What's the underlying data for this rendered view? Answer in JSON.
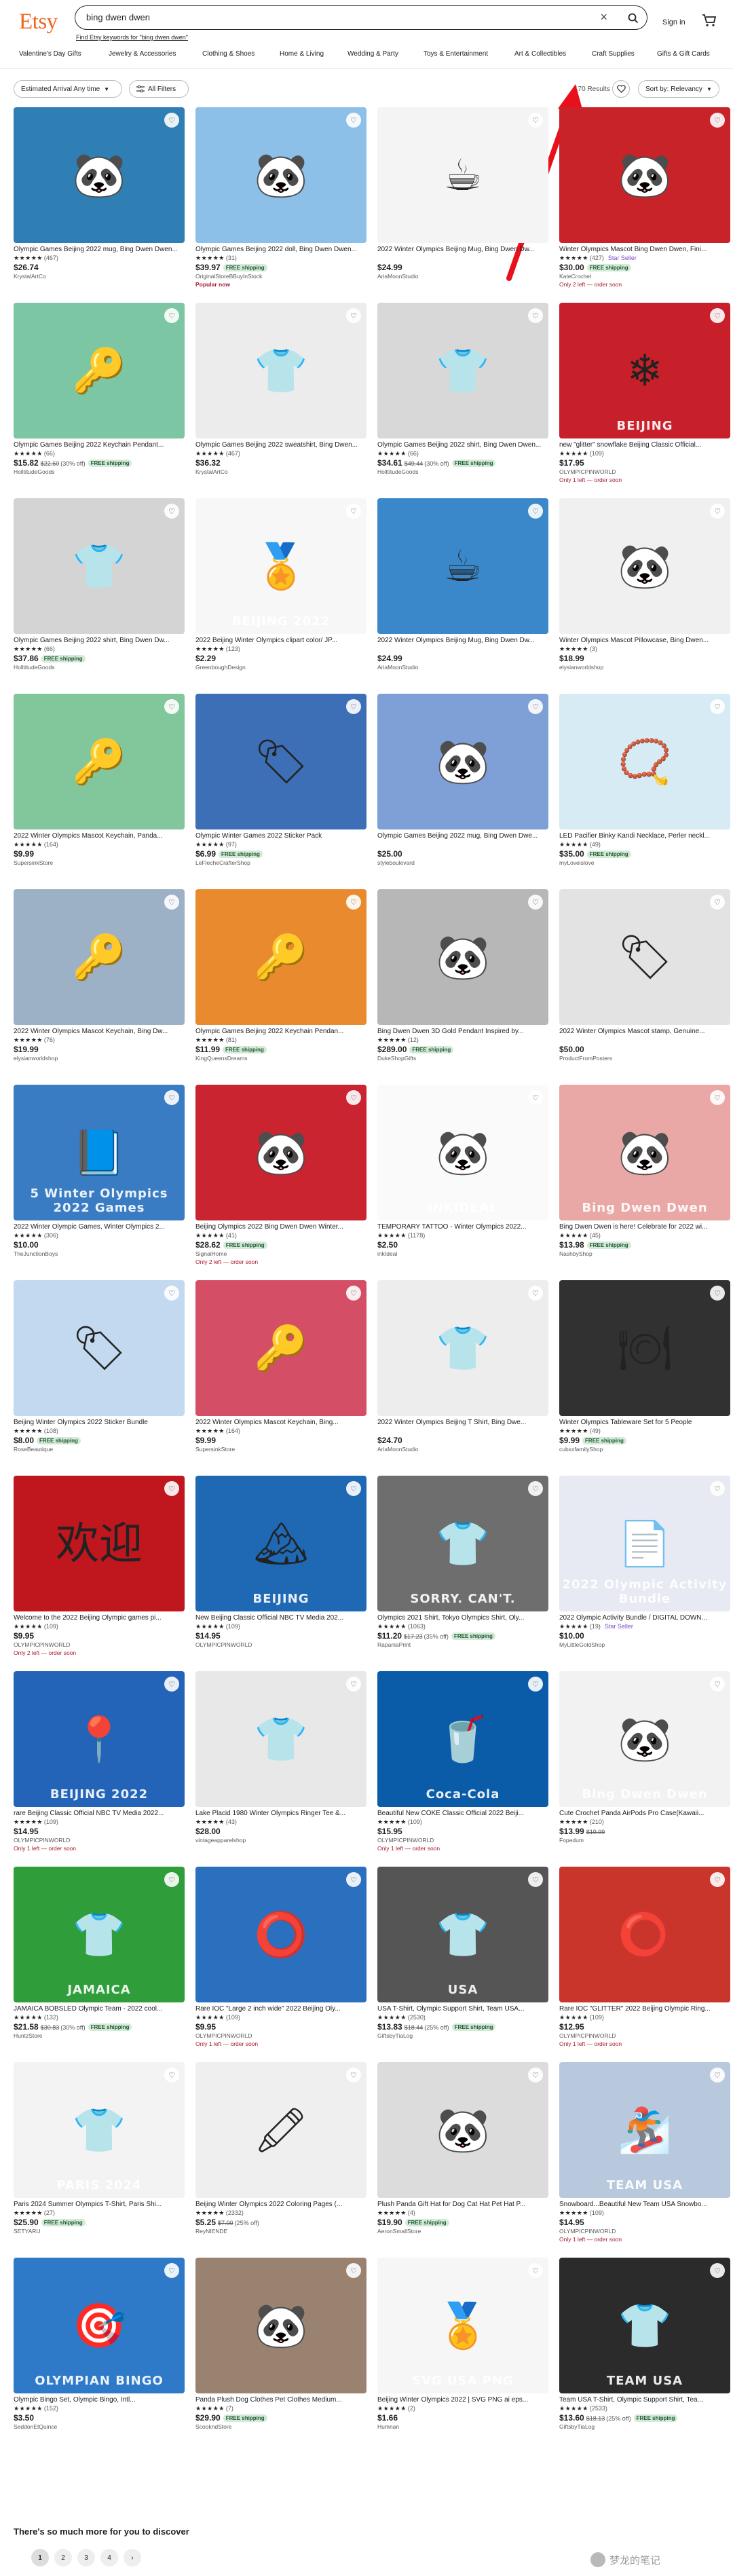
{
  "header": {
    "logo": "Etsy",
    "search_value": "bing dwen dwen",
    "clear_symbol": "×",
    "signin": "Sign in",
    "spell_suggestion": "Find Etsy keywords for \"bing dwen dwen\""
  },
  "categories": [
    "Valentine's Day Gifts",
    "Jewelry & Accessories",
    "Clothing & Shoes",
    "Home & Living",
    "Wedding & Party",
    "Toys & Entertainment",
    "Art & Collectibles",
    "Craft Supplies",
    "Gifts & Gift Cards"
  ],
  "filters": {
    "arrival": "Estimated Arrival Any time",
    "all_filters": "All Filters",
    "results": "170 Results",
    "sort": "Sort by: Relevancy"
  },
  "products": [
    {
      "title": "Olympic Games Beijing 2022 mug, Bing Dwen Dwen...",
      "rating": "★★★★★",
      "count": "(467)",
      "price": "$26.74",
      "shop": "KrystalArtCo",
      "note": "",
      "ship": "",
      "bg": "#2f7fb5",
      "glyph": "🐼",
      "caption": "",
      "seller": ""
    },
    {
      "title": "Olympic Games Beijing 2022 doll, Bing Dwen Dwen...",
      "rating": "★★★★★",
      "count": "(31)",
      "price": "$39.97",
      "shop": "OriginalStoreBBuyInStock",
      "note": "Popular now",
      "ship": "FREE shipping",
      "bg": "#8cc0e8",
      "glyph": "🐼",
      "caption": "",
      "seller": ""
    },
    {
      "title": "2022 Winter Olympics Beijing Mug, Bing Dwen Dw...",
      "rating": "",
      "count": "",
      "price": "$24.99",
      "shop": "AriaMoonStudio",
      "note": "",
      "ship": "",
      "bg": "#f4f4f4",
      "glyph": "☕",
      "caption": "",
      "seller": ""
    },
    {
      "title": "Winter Olympics Mascot Bing Dwen Dwen, Fini...",
      "rating": "★★★★★",
      "count": "(427)",
      "price": "$30.00",
      "shop": "KateCrochet",
      "note": "Only 2 left — order soon",
      "ship": "FREE shipping",
      "bg": "#c9232a",
      "glyph": "🐼",
      "caption": "",
      "seller": "Star Seller"
    },
    {
      "title": "Olympic Games Beijing 2022 Keychain Pendant...",
      "rating": "★★★★★",
      "count": "(66)",
      "price": "$15.82",
      "shop": "HolltitudeGoods",
      "note": "",
      "ship": "FREE shipping",
      "bg": "#7cc6a3",
      "glyph": "🔑",
      "caption": "",
      "seller": "",
      "orig": "$22.60",
      "disc": "(30% off)"
    },
    {
      "title": "Olympic Games Beijing 2022 sweatshirt, Bing Dwen...",
      "rating": "★★★★★",
      "count": "(467)",
      "price": "$36.32",
      "shop": "KrystalArtCo",
      "note": "",
      "ship": "",
      "bg": "#ececec",
      "glyph": "👕",
      "caption": "",
      "seller": ""
    },
    {
      "title": "Olympic Games Beijing 2022 shirt, Bing Dwen Dwen...",
      "rating": "★★★★★",
      "count": "(66)",
      "price": "$34.61",
      "shop": "HolltitudeGoods",
      "note": "",
      "ship": "FREE shipping",
      "bg": "#d8d8d8",
      "glyph": "👕",
      "caption": "",
      "seller": "",
      "orig": "$49.44",
      "disc": "(30% off)"
    },
    {
      "title": "new \"glitter\" snowflake Beijing Classic Official...",
      "rating": "★★★★★",
      "count": "(109)",
      "price": "$17.95",
      "shop": "OLYMPICPINWORLD",
      "note": "Only 1 left — order soon",
      "ship": "",
      "bg": "#c8202a",
      "glyph": "❄",
      "caption": "BEIJING",
      "seller": ""
    },
    {
      "title": "Olympic Games Beijing 2022 shirt, Bing Dwen Dw...",
      "rating": "★★★★★",
      "count": "(66)",
      "price": "$37.86",
      "shop": "HolltitudeGoods",
      "note": "",
      "ship": "FREE shipping",
      "bg": "#d4d4d4",
      "glyph": "👕",
      "caption": "",
      "seller": ""
    },
    {
      "title": "2022 Beijing Winter Olympics clipart color/ JP...",
      "rating": "★★★★★",
      "count": "(123)",
      "price": "$2.29",
      "shop": "GreenboughDesign",
      "note": "",
      "ship": "",
      "bg": "#f7f7f7",
      "glyph": "🏅",
      "caption": "BEIJING 2022",
      "seller": ""
    },
    {
      "title": "2022 Winter Olympics Beijing Mug, Bing Dwen Dw...",
      "rating": "",
      "count": "",
      "price": "$24.99",
      "shop": "AriaMoonStudio",
      "note": "",
      "ship": "",
      "bg": "#3a88c9",
      "glyph": "☕",
      "caption": "",
      "seller": ""
    },
    {
      "title": "Winter Olympics Mascot Pillowcase, Bing Dwen...",
      "rating": "★★★★★",
      "count": "(3)",
      "price": "$18.99",
      "shop": "elysianworldshop",
      "note": "",
      "ship": "",
      "bg": "#f0f0f0",
      "glyph": "🐼",
      "caption": "",
      "seller": ""
    },
    {
      "title": "2022 Winter Olympics Mascot Keychain, Panda...",
      "rating": "★★★★★",
      "count": "(164)",
      "price": "$9.99",
      "shop": "SupersinkStore",
      "note": "",
      "ship": "",
      "bg": "#82c79c",
      "glyph": "🔑",
      "caption": "",
      "seller": ""
    },
    {
      "title": "Olympic Winter Games 2022 Sticker Pack",
      "rating": "★★★★★",
      "count": "(97)",
      "price": "$6.99",
      "shop": "LeFlecheCrafterShop",
      "note": "",
      "ship": "FREE shipping",
      "bg": "#3c6fb6",
      "glyph": "🏷",
      "caption": "",
      "seller": ""
    },
    {
      "title": "Olympic Games Beijing 2022 mug, Bing Dwen Dwe...",
      "rating": "",
      "count": "",
      "price": "$25.00",
      "shop": "styleboulevard",
      "note": "",
      "ship": "",
      "bg": "#7fa0d6",
      "glyph": "🐼",
      "caption": "",
      "seller": ""
    },
    {
      "title": "LED Pacifier Binky Kandi Necklace, Perler neckl...",
      "rating": "★★★★★",
      "count": "(49)",
      "price": "$35.00",
      "shop": "myLoveislove",
      "note": "",
      "ship": "FREE shipping",
      "bg": "#d7ebf5",
      "glyph": "📿",
      "caption": "",
      "seller": ""
    },
    {
      "title": "2022 Winter Olympics Mascot Keychain, Bing Dw...",
      "rating": "★★★★★",
      "count": "(76)",
      "price": "$19.99",
      "shop": "elysianworldshop",
      "note": "",
      "ship": "",
      "bg": "#9cb0c6",
      "glyph": "🔑",
      "caption": "",
      "seller": ""
    },
    {
      "title": "Olympic Games Beijing 2022 Keychain Pendan...",
      "rating": "★★★★★",
      "count": "(81)",
      "price": "$11.99",
      "shop": "KingQueensDreams",
      "note": "",
      "ship": "FREE shipping",
      "bg": "#e98a2f",
      "glyph": "🔑",
      "caption": "",
      "seller": ""
    },
    {
      "title": "Bing Dwen Dwen 3D Gold Pendant Inspired by...",
      "rating": "★★★★★",
      "count": "(12)",
      "price": "$289.00",
      "shop": "DukeShopGifts",
      "note": "",
      "ship": "FREE shipping",
      "bg": "#b7b7b7",
      "glyph": "🐼",
      "caption": "",
      "seller": ""
    },
    {
      "title": "2022 Winter Olympics Mascot stamp, Genuine...",
      "rating": "",
      "count": "",
      "price": "$50.00",
      "shop": "ProductFromPosters",
      "note": "",
      "ship": "",
      "bg": "#e3e3e3",
      "glyph": "🏷",
      "caption": "",
      "seller": ""
    },
    {
      "title": "2022 Winter Olympic Games, Winter Olympics 2...",
      "rating": "★★★★★",
      "count": "(306)",
      "price": "$10.00",
      "shop": "TheJunctionBoys",
      "note": "",
      "ship": "",
      "bg": "#3a7cc4",
      "glyph": "📘",
      "caption": "5 Winter Olympics 2022 Games",
      "seller": ""
    },
    {
      "title": "Beijing Olympics 2022 Bing Dwen Dwen Winter...",
      "rating": "★★★★★",
      "count": "(41)",
      "price": "$28.62",
      "shop": "SignalHome",
      "note": "Only 2 left — order soon",
      "ship": "FREE shipping",
      "bg": "#c92430",
      "glyph": "🐼",
      "caption": "",
      "seller": ""
    },
    {
      "title": "TEMPORARY TATTOO - Winter Olympics 2022...",
      "rating": "★★★★★",
      "count": "(1178)",
      "price": "$2.50",
      "shop": "inkIdeal",
      "note": "",
      "ship": "",
      "bg": "#fafafa",
      "glyph": "🐼",
      "caption": "iNKIDEAL",
      "seller": ""
    },
    {
      "title": "Bing Dwen Dwen is here! Celebrate for 2022 wi...",
      "rating": "★★★★★",
      "count": "(45)",
      "price": "$13.98",
      "shop": "NashbyShop",
      "note": "",
      "ship": "FREE shipping",
      "bg": "#e9a8a5",
      "glyph": "🐼",
      "caption": "Bing Dwen Dwen",
      "seller": ""
    },
    {
      "title": "Beijing Winter Olympics 2022 Sticker Bundle",
      "rating": "★★★★★",
      "count": "(108)",
      "price": "$8.00",
      "shop": "RoseBeautique",
      "note": "",
      "ship": "FREE shipping",
      "bg": "#c2d9ef",
      "glyph": "🏷",
      "caption": "",
      "seller": ""
    },
    {
      "title": "2022 Winter Olympics Mascot Keychain, Bing...",
      "rating": "★★★★★",
      "count": "(164)",
      "price": "$9.99",
      "shop": "SupersinkStore",
      "note": "",
      "ship": "",
      "bg": "#d44f65",
      "glyph": "🔑",
      "caption": "",
      "seller": ""
    },
    {
      "title": "2022 Winter Olympics Beijing T Shirt, Bing Dwe...",
      "rating": "",
      "count": "",
      "price": "$24.70",
      "shop": "AriaMoonStudio",
      "note": "",
      "ship": "",
      "bg": "#ededed",
      "glyph": "👕",
      "caption": "",
      "seller": ""
    },
    {
      "title": "Winter Olympics Tableware Set for 5 People",
      "rating": "★★★★★",
      "count": "(49)",
      "price": "$9.99",
      "shop": "cubxxfamilyShop",
      "note": "",
      "ship": "FREE shipping",
      "bg": "#313131",
      "glyph": "🍽",
      "caption": "",
      "seller": ""
    },
    {
      "title": "Welcome to the 2022 Beijing Olympic games pi...",
      "rating": "★★★★★",
      "count": "(109)",
      "price": "$9.95",
      "shop": "OLYMPICPINWORLD",
      "note": "Only 2 left — order soon",
      "ship": "",
      "bg": "#c0161e",
      "glyph": "欢迎",
      "caption": "",
      "seller": ""
    },
    {
      "title": "New Beijing Classic Official NBC TV Media 202...",
      "rating": "★★★★★",
      "count": "(109)",
      "price": "$14.95",
      "shop": "OLYMPICPINWORLD",
      "note": "",
      "ship": "",
      "bg": "#1f68b3",
      "glyph": "🏔",
      "caption": "BEIJING",
      "seller": ""
    },
    {
      "title": "Olympics 2021 Shirt, Tokyo Olympics Shirt, Oly...",
      "rating": "★★★★★",
      "count": "(1063)",
      "price": "$11.20",
      "shop": "RapaniaPrint",
      "note": "",
      "ship": "FREE shipping",
      "bg": "#6e6e6e",
      "glyph": "👕",
      "caption": "SORRY. CAN'T.",
      "seller": "",
      "orig": "$17.23",
      "disc": "(35% off)"
    },
    {
      "title": "2022 Olympic Activity Bundle / DIGITAL DOWN...",
      "rating": "★★★★★",
      "count": "(19)",
      "price": "$10.00",
      "shop": "MyLittleGoldShop",
      "note": "",
      "ship": "",
      "bg": "#e7eaf3",
      "glyph": "📄",
      "caption": "2022 Olympic Activity Bundle",
      "seller": "Star Seller"
    },
    {
      "title": "rare Beijing Classic Official NBC TV Media 2022...",
      "rating": "★★★★★",
      "count": "(109)",
      "price": "$14.95",
      "shop": "OLYMPICPINWORLD",
      "note": "Only 1 left — order soon",
      "ship": "",
      "bg": "#2464b8",
      "glyph": "📍",
      "caption": "BEIJING 2022",
      "seller": ""
    },
    {
      "title": "Lake Placid 1980 Winter Olympics Ringer Tee &...",
      "rating": "★★★★★",
      "count": "(43)",
      "price": "$28.00",
      "shop": "vintageapparelshop",
      "note": "",
      "ship": "",
      "bg": "#e8e8e8",
      "glyph": "👕",
      "caption": "",
      "seller": ""
    },
    {
      "title": "Beautiful New COKE Classic Official 2022 Beiji...",
      "rating": "★★★★★",
      "count": "(109)",
      "price": "$15.95",
      "shop": "OLYMPICPINWORLD",
      "note": "Only 1 left — order soon",
      "ship": "",
      "bg": "#0a5ba8",
      "glyph": "🥤",
      "caption": "Coca-Cola",
      "seller": ""
    },
    {
      "title": "Cute Crochet Panda AirPods Pro Case(Kawaii...",
      "rating": "★★★★★",
      "count": "(210)",
      "price": "$13.99",
      "shop": "Fopedum",
      "note": "",
      "ship": "",
      "bg": "#f2f2f2",
      "glyph": "🐼",
      "caption": "Bing Dwen Dwen",
      "seller": "",
      "orig": "$19.99"
    },
    {
      "title": "JAMAICA BOBSLED Olympic Team - 2022 cool...",
      "rating": "★★★★★",
      "count": "(132)",
      "price": "$21.58",
      "shop": "HuntzStore",
      "note": "",
      "ship": "FREE shipping",
      "bg": "#2e9d3a",
      "glyph": "👕",
      "caption": "JAMAICA",
      "seller": "",
      "orig": "$30.83",
      "disc": "(30% off)"
    },
    {
      "title": "Rare IOC \"Large 2 inch wide\" 2022 Beijing Oly...",
      "rating": "★★★★★",
      "count": "(109)",
      "price": "$9.95",
      "shop": "OLYMPICPINWORLD",
      "note": "Only 1 left — order soon",
      "ship": "",
      "bg": "#2b6fbf",
      "glyph": "⭕",
      "caption": "",
      "seller": ""
    },
    {
      "title": "USA T-Shirt, Olympic Support Shirt, Team USA...",
      "rating": "★★★★★",
      "count": "(2530)",
      "price": "$13.83",
      "shop": "GiftsbyTiaLog",
      "note": "",
      "ship": "FREE shipping",
      "bg": "#555555",
      "glyph": "👕",
      "caption": "USA",
      "seller": "",
      "orig": "$18.44",
      "disc": "(25% off)"
    },
    {
      "title": "Rare IOC \"GLITTER\" 2022 Beijing Olympic Ring...",
      "rating": "★★★★★",
      "count": "(109)",
      "price": "$12.95",
      "shop": "OLYMPICPINWORLD",
      "note": "Only 1 left — order soon",
      "ship": "",
      "bg": "#c9342b",
      "glyph": "⭕",
      "caption": "",
      "seller": ""
    },
    {
      "title": "Paris 2024 Summer Olympics T-Shirt, Paris Shi...",
      "rating": "★★★★★",
      "count": "(27)",
      "price": "$25.90",
      "shop": "SETYARU",
      "note": "",
      "ship": "FREE shipping",
      "bg": "#f3f3f3",
      "glyph": "👕",
      "caption": "PARIS 2024",
      "seller": ""
    },
    {
      "title": "Beijing Winter Olympics 2022 Coloring Pages (...",
      "rating": "★★★★★",
      "count": "(2332)",
      "price": "$5.25",
      "shop": "ReyNIENDE",
      "note": "",
      "ship": "",
      "bg": "#efefef",
      "glyph": "🖍",
      "caption": "",
      "seller": "",
      "orig": "$7.00",
      "disc": "(25% off)"
    },
    {
      "title": "Plush Panda Gift Hat for Dog Cat Hat Pet Hat P...",
      "rating": "★★★★★",
      "count": "(4)",
      "price": "$19.90",
      "shop": "AeronSmallStore",
      "note": "",
      "ship": "FREE shipping",
      "bg": "#dcdcdc",
      "glyph": "🐼",
      "caption": "",
      "seller": ""
    },
    {
      "title": "Snowboard...Beautiful New Team USA Snowbo...",
      "rating": "★★★★★",
      "count": "(109)",
      "price": "$14.95",
      "shop": "OLYMPICPINWORLD",
      "note": "Only 1 left — order soon",
      "ship": "",
      "bg": "#b8c9dd",
      "glyph": "🏂",
      "caption": "TEAM USA",
      "seller": ""
    },
    {
      "title": "Olympic Bingo Set, Olympic Bingo, Intl...",
      "rating": "★★★★★",
      "count": "(152)",
      "price": "$3.50",
      "shop": "SeddonEtQuince",
      "note": "",
      "ship": "",
      "bg": "#2e7ac8",
      "glyph": "🎯",
      "caption": "OLYMPIAN BINGO",
      "seller": ""
    },
    {
      "title": "Panda Plush Dog Clothes Pet Clothes Medium...",
      "rating": "★★★★★",
      "count": "(7)",
      "price": "$29.90",
      "shop": "ScookndStore",
      "note": "",
      "ship": "FREE shipping",
      "bg": "#9a8270",
      "glyph": "🐼",
      "caption": "",
      "seller": ""
    },
    {
      "title": "Beijing Winter Olympics 2022 | SVG PNG ai eps...",
      "rating": "★★★★★",
      "count": "(2)",
      "price": "$1.66",
      "shop": "Humnan",
      "note": "",
      "ship": "",
      "bg": "#f6f6f6",
      "glyph": "🏅",
      "caption": "SVG USA PNG",
      "seller": ""
    },
    {
      "title": "Team USA T-Shirt, Olympic Support Shirt, Tea...",
      "rating": "★★★★★",
      "count": "(2533)",
      "price": "$13.60",
      "shop": "GiftsbyTiaLog",
      "note": "",
      "ship": "FREE shipping",
      "bg": "#2b2b2b",
      "glyph": "👕",
      "caption": "TEAM USA",
      "seller": "",
      "orig": "$18.13",
      "disc": "(25% off)"
    }
  ],
  "footer": {
    "more_text": "There's so much more for you to discover",
    "pages": [
      "1",
      "2",
      "3",
      "4",
      "›"
    ],
    "watermark": "梦龙的笔记"
  },
  "colors": {
    "brand": "#f1641e",
    "free_shipping_bg": "#d4e9d8",
    "annotation_arrow": "#e8101a"
  },
  "icons": {
    "search": "search-icon",
    "cart": "cart-icon",
    "filter": "filter-icon",
    "favorite": "heart-icon"
  }
}
